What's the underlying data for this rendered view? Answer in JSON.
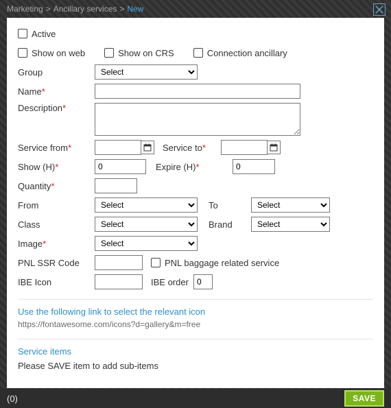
{
  "breadcrumb": {
    "a": "Marketing",
    "b": "Ancillary services",
    "c": "New",
    "sep": ">"
  },
  "labels": {
    "active": "Active",
    "showWeb": "Show on web",
    "showCRS": "Show on CRS",
    "connAnc": "Connection ancillary",
    "group": "Group",
    "name": "Name",
    "description": "Description",
    "serviceFrom": "Service from",
    "serviceTo": "Service to",
    "showH": "Show (H)",
    "expireH": "Expire (H)",
    "quantity": "Quantity",
    "from": "From",
    "to": "To",
    "class": "Class",
    "brand": "Brand",
    "image": "Image",
    "pnlSSR": "PNL SSR Code",
    "pnlBag": "PNL baggage related service",
    "ibeIcon": "IBE Icon",
    "ibeOrder": "IBE order"
  },
  "values": {
    "selectOpt": "Select",
    "zero": "0",
    "name": "",
    "description": "",
    "serviceFrom": "",
    "serviceTo": "",
    "quantity": "",
    "pnlSSR": "",
    "ibeIcon": ""
  },
  "linkSection": {
    "title": "Use the following link to select the relevant icon",
    "url": "https://fontawesome.com/icons?d=gallery&m=free"
  },
  "serviceItems": {
    "title": "Service items",
    "note": "Please SAVE item to add sub-items"
  },
  "footer": {
    "count": "(0)",
    "save": "SAVE"
  }
}
